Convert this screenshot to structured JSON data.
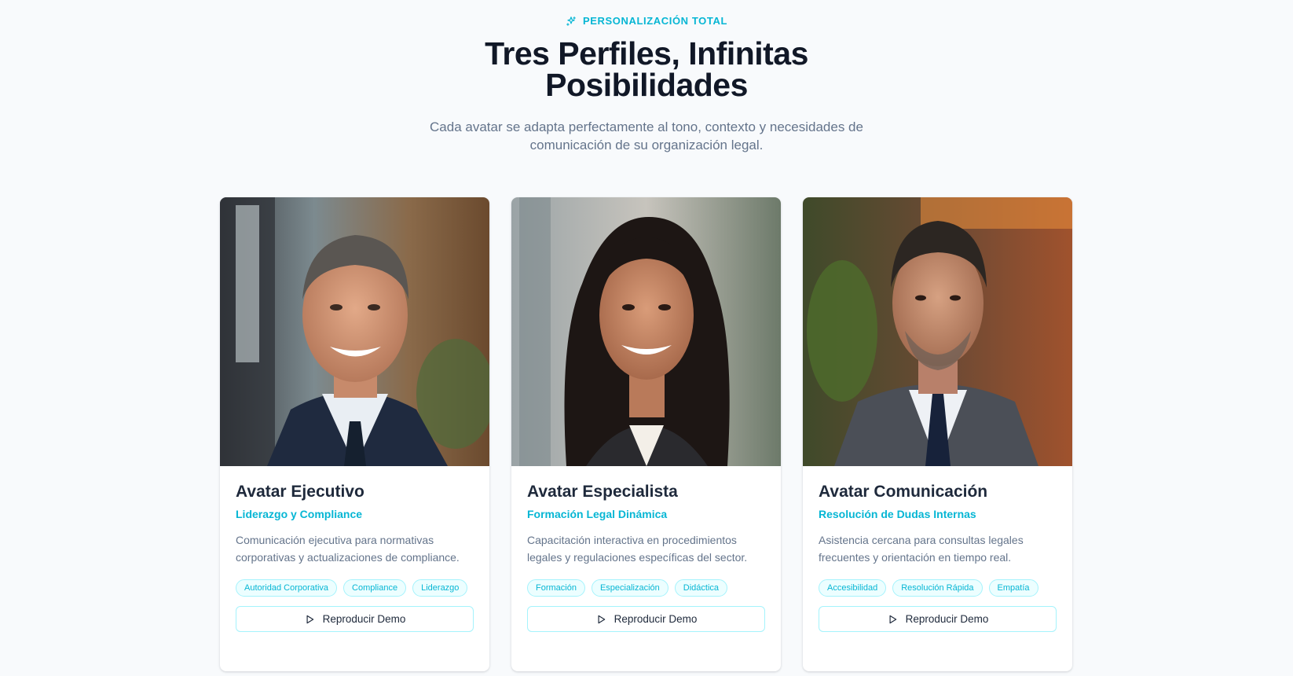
{
  "header": {
    "eyebrow": "PERSONALIZACIÓN TOTAL",
    "eyebrow_icon": "sparkles-icon",
    "title_line1": "Tres Perfiles, Infinitas",
    "title_line2": "Posibilidades",
    "subtitle_line1": "Cada avatar se adapta perfectamente al tono, contexto y necesidades de",
    "subtitle_line2": "comunicación de su organización legal."
  },
  "colors": {
    "accent": "#06b6d4",
    "heading": "#111827",
    "muted": "#64748b",
    "background": "#f8fafc"
  },
  "cards": [
    {
      "name": "Avatar Ejecutivo",
      "role": "Liderazgo y Compliance",
      "description": "Comunicación ejecutiva para normativas corporativas y actualizaciones de compliance.",
      "tags": [
        "Autoridad Corporativa",
        "Compliance",
        "Liderazgo"
      ],
      "button_label": "Reproducir Demo",
      "button_icon": "play-icon"
    },
    {
      "name": "Avatar Especialista",
      "role": "Formación Legal Dinámica",
      "description": "Capacitación interactiva en procedimientos legales y regulaciones específicas del sector.",
      "tags": [
        "Formación",
        "Especialización",
        "Didáctica"
      ],
      "button_label": "Reproducir Demo",
      "button_icon": "play-icon"
    },
    {
      "name": "Avatar Comunicación",
      "role": "Resolución de Dudas Internas",
      "description": "Asistencia cercana para consultas legales frecuentes y orientación en tiempo real.",
      "tags": [
        "Accesibilidad",
        "Resolución Rápida",
        "Empatía"
      ],
      "button_label": "Reproducir Demo",
      "button_icon": "play-icon"
    }
  ]
}
